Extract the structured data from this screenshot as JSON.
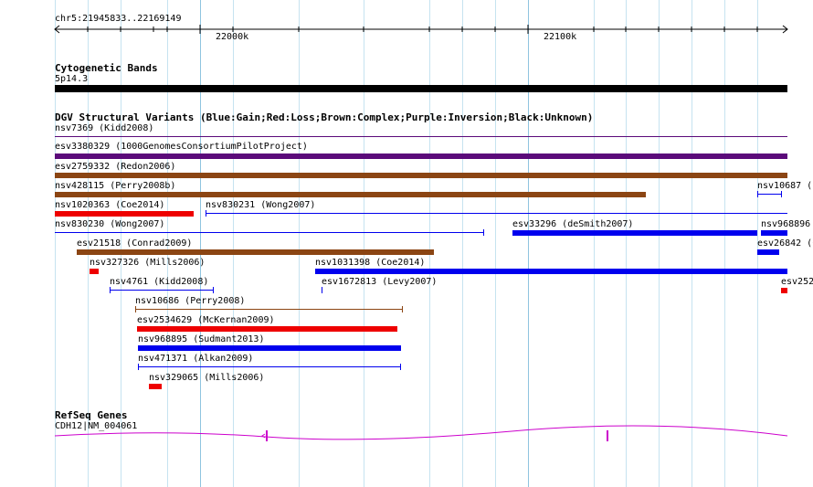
{
  "ruler": {
    "location": "chr5:21945833..22169149",
    "major_labels": [
      "22000k",
      "22100k"
    ]
  },
  "cyto": {
    "title": "Cytogenetic Bands",
    "band": "5p14.3"
  },
  "dgv": {
    "title": "DGV Structural Variants (Blue:Gain;Red:Loss;Brown:Complex;Purple:Inversion;Black:Unknown)",
    "colors": {
      "gain": "#0000ee",
      "loss": "#ee0000",
      "complex": "#8b4513",
      "inversion": "#5b0a7a",
      "unknown": "#000000"
    },
    "variants": [
      "nsv7369 (Kidd2008)",
      "esv3380329 (1000GenomesConsortiumPilotProject)",
      "esv2759332 (Redon2006)",
      "nsv428115 (Perry2008b)",
      "nsv10687 (P",
      "nsv1020363 (Coe2014)",
      "nsv830231 (Wong2007)",
      "nsv830230 (Wong2007)",
      "esv33296 (deSmith2007)",
      "nsv968896",
      "esv21518 (Conrad2009)",
      "esv26842 (C",
      "nsv327326 (Mills2006)",
      "nsv1031398 (Coe2014)",
      "nsv4761 (Kidd2008)",
      "esv1672813 (Levy2007)",
      "esv252",
      "nsv10686 (Perry2008)",
      "esv2534629 (McKernan2009)",
      "nsv968895 (Sudmant2013)",
      "nsv471371 (Alkan2009)",
      "nsv329065 (Mills2006)"
    ]
  },
  "refseq": {
    "title": "RefSeq Genes",
    "gene": "CDH12|NM_004061",
    "color": "#cc00cc"
  }
}
